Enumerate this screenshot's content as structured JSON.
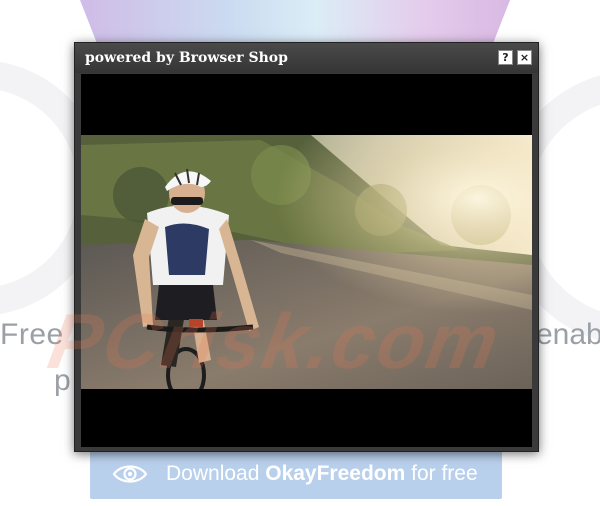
{
  "background": {
    "text_left": "Free",
    "text_left_second_line": "p",
    "text_right": "enab",
    "download_button": {
      "prefix": "Download ",
      "brand": "OkayFreedom",
      "suffix": " for free"
    }
  },
  "popup": {
    "title": "powered by Browser Shop",
    "help_label": "?",
    "close_label": "×"
  },
  "colors": {
    "popup_frame": "#3a3a3a",
    "download_button": "#b9d0ec",
    "video_letterbox": "#000000"
  },
  "video": {
    "scene": "cyclist-on-road-at-sunset"
  }
}
